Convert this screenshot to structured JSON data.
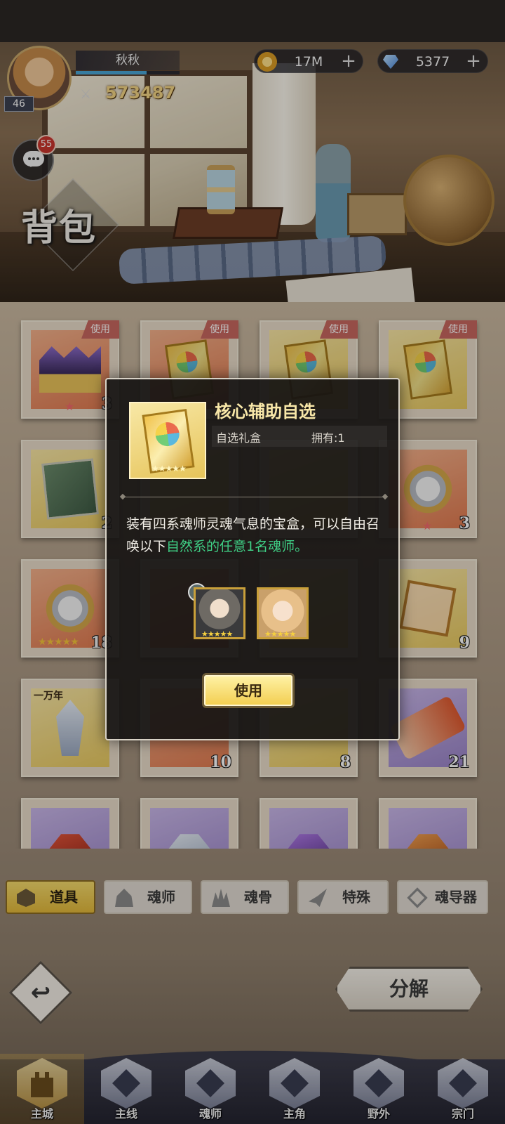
{
  "player": {
    "name": "秋秋",
    "level": "46",
    "power": "573487",
    "exp_fraction": 0.68
  },
  "resources": {
    "gold": {
      "icon": "gold-coin-icon",
      "value": "17M",
      "plus": "+"
    },
    "diamond": {
      "icon": "diamond-icon",
      "value": "5377",
      "plus": "+"
    }
  },
  "chat": {
    "unread": "55"
  },
  "page_title": "背包",
  "grid": {
    "use_tag": "使用",
    "counts": {
      "r1c1": "3",
      "r2c1": "2",
      "r2c4": "3",
      "r3c1": "18",
      "r3c4": "9",
      "r4c2": "10",
      "r4c3": "8",
      "r4c4": "21"
    },
    "wannian_label": "一万年"
  },
  "modal": {
    "title": "核心辅助自选",
    "type": "自选礼盒",
    "owned": "拥有:1",
    "desc_prefix": "装有四系魂师灵魂气息的宝盒，可以自由召唤以下",
    "desc_highlight": "自然系的任意1名魂师。",
    "stars": "★★★★★",
    "use_button": "使用",
    "highlight_color": "#3fcf85"
  },
  "tabs": [
    {
      "label": "道具",
      "icon": "item-box-icon",
      "active": true
    },
    {
      "label": "魂师",
      "icon": "hooded-figure-icon",
      "active": false
    },
    {
      "label": "魂骨",
      "icon": "spike-icon",
      "active": false
    },
    {
      "label": "特殊",
      "icon": "feather-icon",
      "active": false
    },
    {
      "label": "魂导器",
      "icon": "device-diamond-icon",
      "active": false
    }
  ],
  "actions": {
    "back_glyph": "↩",
    "decompose": "分解"
  },
  "nav": [
    {
      "label": "主城",
      "active": true
    },
    {
      "label": "主线",
      "active": false
    },
    {
      "label": "魂师",
      "active": false
    },
    {
      "label": "主角",
      "active": false
    },
    {
      "label": "野外",
      "active": false
    },
    {
      "label": "宗门",
      "active": false
    }
  ],
  "colors": {
    "accent_gold": "#f2cd4e",
    "tag_red": "#c7675f",
    "badge_red": "#c8342c"
  }
}
